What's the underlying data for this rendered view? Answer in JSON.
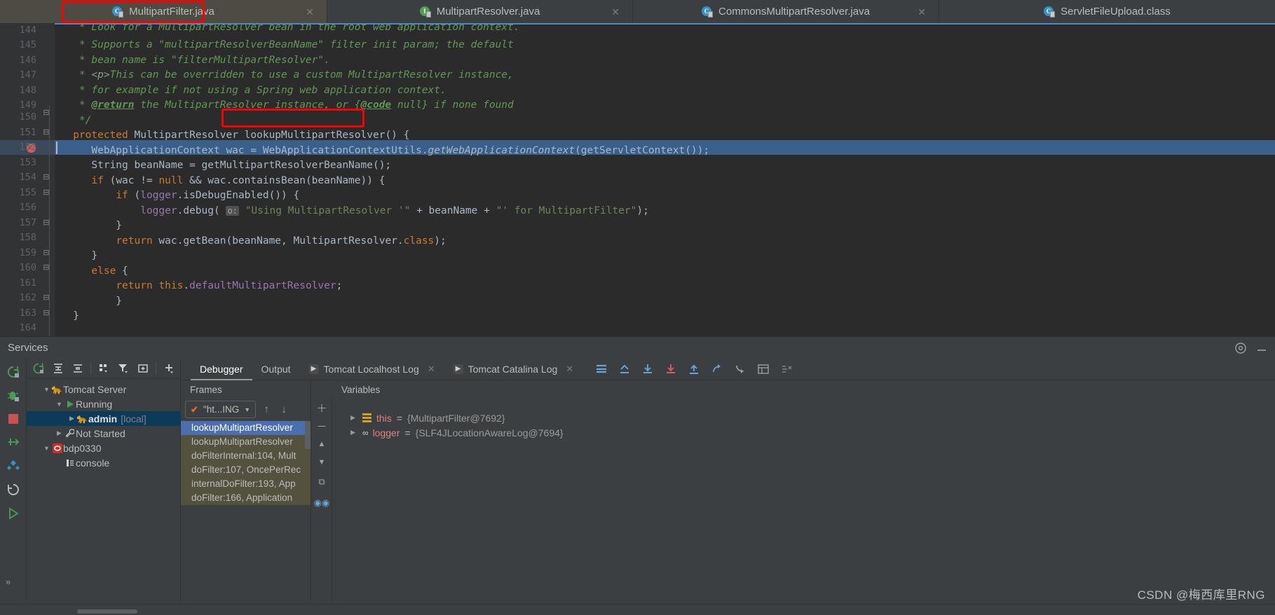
{
  "editor_tabs": [
    {
      "label": "MultipartFilter.java",
      "icon": "java-class-icon",
      "icon_letter": "C",
      "active": true,
      "closable": true
    },
    {
      "label": "MultipartResolver.java",
      "icon": "java-interface-icon",
      "icon_letter": "I",
      "active": false,
      "closable": true
    },
    {
      "label": "CommonsMultipartResolver.java",
      "icon": "java-class-icon",
      "icon_letter": "C",
      "active": false,
      "closable": true
    },
    {
      "label": "ServletFileUpload.class",
      "icon": "java-class-icon",
      "icon_letter": "C",
      "active": false,
      "closable": false
    }
  ],
  "tab_close_glyph": "✕",
  "code": {
    "first_visible_line": 144,
    "highlighted_line": 152,
    "breakpoint_line": 152,
    "lines": [
      {
        "n": 144,
        "text": "  * Look for a MultipartResolver bean in the root web application context.",
        "partial": true
      },
      {
        "n": 145,
        "text": "  * Supports a \"multipartResolverBeanName\" filter init param; the default"
      },
      {
        "n": 146,
        "text": "  * bean name is \"filterMultipartResolver\"."
      },
      {
        "n": 147,
        "text": "  * <p>This can be overridden to use a custom MultipartResolver instance,"
      },
      {
        "n": 148,
        "text": "  * for example if not using a Spring web application context."
      },
      {
        "n": 149,
        "text": "  * @return the MultipartResolver instance, or {@code null} if none found"
      },
      {
        "n": 150,
        "text": "  */"
      },
      {
        "n": 151,
        "text": " protected MultipartResolver lookupMultipartResolver() {"
      },
      {
        "n": 152,
        "text": "     WebApplicationContext wac = WebApplicationContextUtils.getWebApplicationContext(getServletContext());"
      },
      {
        "n": 153,
        "text": "     String beanName = getMultipartResolverBeanName();"
      },
      {
        "n": 154,
        "text": "     if (wac != null && wac.containsBean(beanName)) {"
      },
      {
        "n": 155,
        "text": "         if (logger.isDebugEnabled()) {"
      },
      {
        "n": 156,
        "text": "             logger.debug( o: \"Using MultipartResolver '\" + beanName + \"' for MultipartFilter\");"
      },
      {
        "n": 157,
        "text": "         }"
      },
      {
        "n": 158,
        "text": "         return wac.getBean(beanName, MultipartResolver.class);"
      },
      {
        "n": 159,
        "text": "     }"
      },
      {
        "n": 160,
        "text": "     else {"
      },
      {
        "n": 161,
        "text": "         return this.defaultMultipartResolver;"
      },
      {
        "n": 162,
        "text": "     }"
      },
      {
        "n": 163,
        "text": " }"
      },
      {
        "n": 164,
        "text": ""
      }
    ],
    "annotations": {
      "method_name_box": "lookupMultipartResolver()",
      "param_hint": "o:"
    }
  },
  "services": {
    "title": "Services",
    "toolbar": [
      {
        "name": "rerun-icon",
        "glyph": "⟳"
      },
      {
        "name": "expand-all-icon",
        "glyph": "⇲"
      },
      {
        "name": "collapse-all-icon",
        "glyph": "⇱"
      },
      {
        "name": "group-by-icon",
        "glyph": "▦"
      },
      {
        "name": "filter-icon",
        "glyph": "▼"
      },
      {
        "name": "add-frame-icon",
        "glyph": "⊞"
      },
      {
        "name": "add-icon",
        "glyph": "＋"
      }
    ],
    "left_toolbar": [
      {
        "name": "rerun-service-icon",
        "glyph": "⟳",
        "color": "#499c54"
      },
      {
        "name": "debug-service-icon",
        "glyph": "🐞",
        "color": "#499c54"
      },
      {
        "name": "stop-service-icon",
        "glyph": "■",
        "color": "#c75450"
      },
      {
        "name": "step-over-icon",
        "glyph": "⇥",
        "color": "#499c54"
      },
      {
        "name": "settings-deploy-icon",
        "glyph": "❖",
        "color": "#3592c4"
      },
      {
        "name": "restart-icon",
        "glyph": "⟲",
        "color": "#bbbbbb"
      },
      {
        "name": "resume-icon",
        "glyph": "▶",
        "color": "#499c54"
      },
      {
        "name": "more-icon",
        "glyph": "»",
        "color": "#bbbbbb"
      }
    ],
    "tree": [
      {
        "indent": 0,
        "twisty": "▼",
        "icon": "tomcat-icon",
        "label": "Tomcat Server",
        "sub": "",
        "selected": false,
        "bold": false
      },
      {
        "indent": 1,
        "twisty": "▼",
        "icon": "run-icon",
        "label": "Running",
        "sub": "",
        "selected": false,
        "bold": false
      },
      {
        "indent": 2,
        "twisty": "▶",
        "icon": "tomcat-running-icon",
        "label": "admin",
        "sub": "[local]",
        "selected": true,
        "bold": true
      },
      {
        "indent": 1,
        "twisty": "▶",
        "icon": "wrench-icon",
        "label": "Not Started",
        "sub": "",
        "selected": false,
        "bold": false
      },
      {
        "indent": 0,
        "twisty": "▼",
        "icon": "stop-red-icon",
        "label": "bdp0330",
        "sub": "",
        "selected": false,
        "bold": false
      },
      {
        "indent": 1,
        "twisty": "",
        "icon": "console-icon",
        "label": "console",
        "sub": "",
        "selected": false,
        "bold": false
      }
    ]
  },
  "debugger": {
    "tabs": [
      {
        "label": "Debugger",
        "active": true,
        "has_run_icon": false,
        "closable": false
      },
      {
        "label": "Output",
        "active": false,
        "has_run_icon": false,
        "closable": false
      },
      {
        "label": "Tomcat Localhost Log",
        "active": false,
        "has_run_icon": true,
        "closable": true
      },
      {
        "label": "Tomcat Catalina Log",
        "active": false,
        "has_run_icon": true,
        "closable": true
      }
    ],
    "close_glyph": "✕",
    "run_glyph": "▶",
    "toolbar_icons": [
      {
        "name": "console-view-icon",
        "glyph": "≡",
        "color": "#6aa3d8"
      },
      {
        "name": "step-out-up-icon",
        "glyph": "⌃",
        "color": "#6aa3d8"
      },
      {
        "name": "step-over-icon",
        "glyph": "↓",
        "color": "#6aa3d8"
      },
      {
        "name": "step-into-icon",
        "glyph": "↓",
        "color": "#d4605c"
      },
      {
        "name": "force-step-into-icon",
        "glyph": "↑",
        "color": "#6aa3d8"
      },
      {
        "name": "step-out-icon",
        "glyph": "⤴",
        "color": "#6aa3d8"
      },
      {
        "name": "run-to-cursor-icon",
        "glyph": "⤵",
        "color": "#6aa3d8"
      },
      {
        "name": "evaluate-expression-icon",
        "glyph": "▦",
        "color": "#9aa0a6"
      },
      {
        "name": "mute-breakpoints-icon",
        "glyph": "⧉",
        "color": "#9aa0a6"
      }
    ],
    "frames": {
      "title": "Frames",
      "thread_selector": "\"ht...ING",
      "thread_check_glyph": "✔",
      "dropdown_glyph": "▼",
      "up_glyph": "↑",
      "down_glyph": "↓",
      "items": [
        {
          "label": "lookupMultipartResolver",
          "selected": true
        },
        {
          "label": "lookupMultipartResolver",
          "selected": false
        },
        {
          "label": "doFilterInternal:104, Mult",
          "selected": false
        },
        {
          "label": "doFilter:107, OncePerRec",
          "selected": false
        },
        {
          "label": "internalDoFilter:193, App",
          "selected": false
        },
        {
          "label": "doFilter:166, Application",
          "selected": false
        }
      ]
    },
    "variables": {
      "title": "Variables",
      "add_glyph": "＋",
      "remove_glyph": "－",
      "up_glyph": "▲",
      "down_glyph": "▼",
      "copy_glyph": "⧉",
      "watches_glyph": "◉◉",
      "rows": [
        {
          "twisty": "▶",
          "icon": "field-icon",
          "name": "this",
          "eq": "=",
          "value": "{MultipartFilter@7692}"
        },
        {
          "twisty": "▶",
          "icon": "glasses-icon",
          "name": "logger",
          "eq": "=",
          "value": "{SLF4JLocationAwareLog@7694}"
        }
      ]
    }
  },
  "watermark": "CSDN @梅西库里RNG",
  "colors": {
    "highlight_box": "#ff0000",
    "selection_blue": "#3a5f8a",
    "frame_selected": "#4b6eaf",
    "tree_selected": "#0d3a58",
    "editor_bg": "#2b2b2b",
    "panel_bg": "#3c3f41"
  }
}
